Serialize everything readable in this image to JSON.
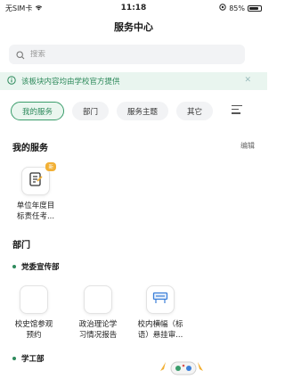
{
  "status_bar": {
    "carrier": "无SIM卡",
    "time": "11:18",
    "battery_text": "85%",
    "battery_level": 0.85
  },
  "page": {
    "title": "服务中心"
  },
  "search": {
    "placeholder": "搜索"
  },
  "notice": {
    "text": "该板块内容均由学校官方提供"
  },
  "tabs": [
    {
      "label": "我的服务",
      "active": true
    },
    {
      "label": "部门",
      "active": false
    },
    {
      "label": "服务主题",
      "active": false
    },
    {
      "label": "其它",
      "active": false
    }
  ],
  "my_services": {
    "title": "我的服务",
    "edit_label": "编辑",
    "items": [
      {
        "label_line1": "单位年度目",
        "label_line2": "标责任考...",
        "tag": "新"
      }
    ]
  },
  "departments": {
    "title": "部门",
    "groups": [
      {
        "name": "党委宣传部",
        "items": [
          {
            "label_line1": "校史馆参观",
            "label_line2": "预约"
          },
          {
            "label_line1": "政治理论学",
            "label_line2": "习情况报告"
          },
          {
            "label_line1": "校内横幅（标",
            "label_line2": "语）悬挂审..."
          }
        ]
      },
      {
        "name": "学工部",
        "items": []
      }
    ]
  },
  "colors": {
    "accent": "#2e8a5c",
    "notice_bg": "#e9f5ef",
    "tag": "#f2b035",
    "icon_blue": "#3b7fd9"
  }
}
